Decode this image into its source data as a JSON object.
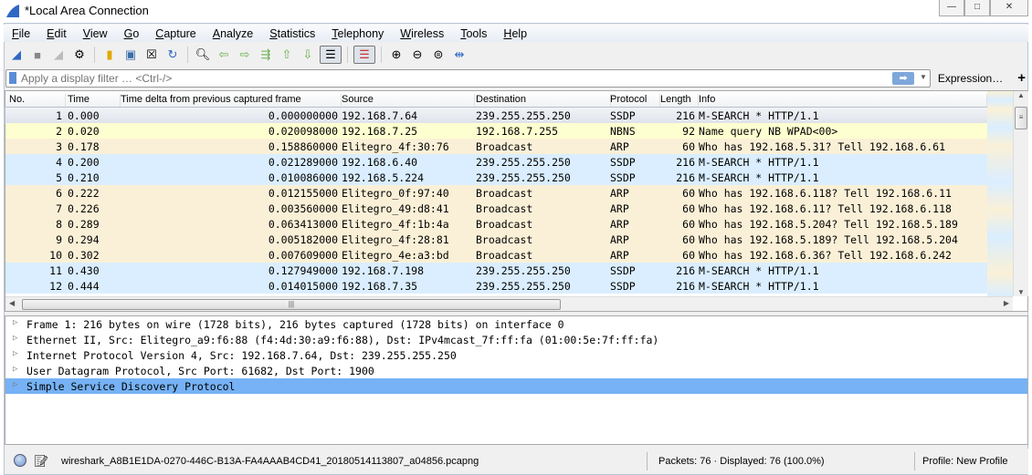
{
  "window": {
    "title": "*Local Area Connection",
    "buttons": [
      "—",
      "□",
      "✕"
    ]
  },
  "menu": [
    "File",
    "Edit",
    "View",
    "Go",
    "Capture",
    "Analyze",
    "Statistics",
    "Telephony",
    "Wireless",
    "Tools",
    "Help"
  ],
  "filter": {
    "placeholder": "Apply a display filter … <Ctrl-/>",
    "expression_label": "Expression…",
    "plus_label": "+"
  },
  "columns": [
    "No.",
    "Time",
    "Time delta from previous captured frame",
    "Source",
    "Destination",
    "Protocol",
    "Length",
    "Info"
  ],
  "colors": {
    "SSDP": "#daeeff",
    "NBNS": "#feffd0",
    "ARP": "#faf0d7",
    "selected": "#e4e8ef",
    "detail_selected": "#76b2f5"
  },
  "packets": [
    [
      "1",
      "0.000",
      "0.000000000",
      "192.168.7.64",
      "239.255.255.250",
      "SSDP",
      "216",
      "M-SEARCH * HTTP/1.1"
    ],
    [
      "2",
      "0.020",
      "0.020098000",
      "192.168.7.25",
      "192.168.7.255",
      "NBNS",
      "92",
      "Name query NB WPAD<00>"
    ],
    [
      "3",
      "0.178",
      "0.158860000",
      "Elitegro_4f:30:76",
      "Broadcast",
      "ARP",
      "60",
      "Who has 192.168.5.31? Tell 192.168.6.61"
    ],
    [
      "4",
      "0.200",
      "0.021289000",
      "192.168.6.40",
      "239.255.255.250",
      "SSDP",
      "216",
      "M-SEARCH * HTTP/1.1"
    ],
    [
      "5",
      "0.210",
      "0.010086000",
      "192.168.5.224",
      "239.255.255.250",
      "SSDP",
      "216",
      "M-SEARCH * HTTP/1.1"
    ],
    [
      "6",
      "0.222",
      "0.012155000",
      "Elitegro_0f:97:40",
      "Broadcast",
      "ARP",
      "60",
      "Who has 192.168.6.118? Tell 192.168.6.11"
    ],
    [
      "7",
      "0.226",
      "0.003560000",
      "Elitegro_49:d8:41",
      "Broadcast",
      "ARP",
      "60",
      "Who has 192.168.6.11? Tell 192.168.6.118"
    ],
    [
      "8",
      "0.289",
      "0.063413000",
      "Elitegro_4f:1b:4a",
      "Broadcast",
      "ARP",
      "60",
      "Who has 192.168.5.204? Tell 192.168.5.189"
    ],
    [
      "9",
      "0.294",
      "0.005182000",
      "Elitegro_4f:28:81",
      "Broadcast",
      "ARP",
      "60",
      "Who has 192.168.5.189? Tell 192.168.5.204"
    ],
    [
      "10",
      "0.302",
      "0.007609000",
      "Elitegro_4e:a3:bd",
      "Broadcast",
      "ARP",
      "60",
      "Who has 192.168.6.36? Tell 192.168.6.242"
    ],
    [
      "11",
      "0.430",
      "0.127949000",
      "192.168.7.198",
      "239.255.255.250",
      "SSDP",
      "216",
      "M-SEARCH * HTTP/1.1"
    ],
    [
      "12",
      "0.444",
      "0.014015000",
      "192.168.7.35",
      "239.255.255.250",
      "SSDP",
      "216",
      "M-SEARCH * HTTP/1.1"
    ]
  ],
  "details": [
    "Frame 1: 216 bytes on wire (1728 bits), 216 bytes captured (1728 bits) on interface 0",
    "Ethernet II, Src: Elitegro_a9:f6:88 (f4:4d:30:a9:f6:88), Dst: IPv4mcast_7f:ff:fa (01:00:5e:7f:ff:fa)",
    "Internet Protocol Version 4, Src: 192.168.7.64, Dst: 239.255.255.250",
    "User Datagram Protocol, Src Port: 61682, Dst Port: 1900",
    "Simple Service Discovery Protocol"
  ],
  "status": {
    "file": "wireshark_A8B1E1DA-0270-446C-B13A-FA4AAAB4CD41_20180514113807_a04856.pcapng",
    "packets": "Packets: 76 · Displayed: 76 (100.0%)",
    "profile": "Profile: New Profile"
  }
}
